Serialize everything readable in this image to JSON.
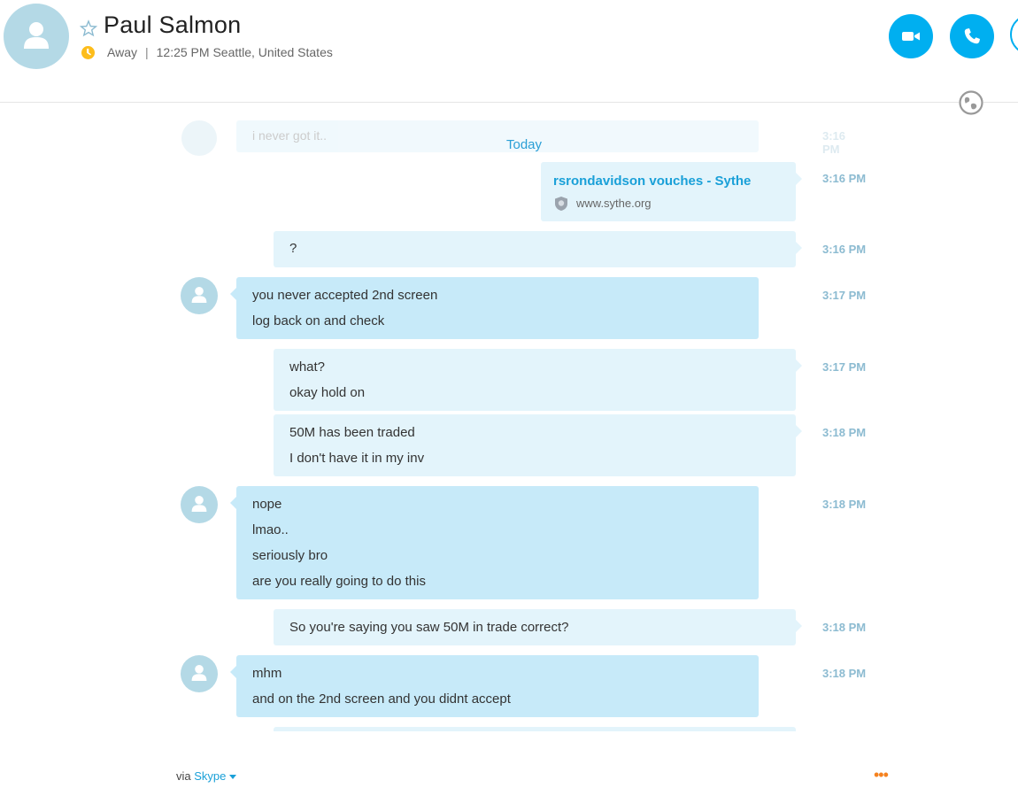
{
  "contact": {
    "name": "Paul Salmon",
    "status": "Away",
    "separator": "|",
    "local_time": "12:25 PM Seattle, United States"
  },
  "header": {
    "video_call_icon": "video-camera-icon",
    "audio_call_icon": "phone-icon"
  },
  "chat": {
    "ghost_text": "i never got it..",
    "ghost_time": "3:16 PM",
    "date_divider": "Today",
    "messages": [
      {
        "dir": "out",
        "type": "link",
        "title": "rsrondavidson vouches - Sythe",
        "url": "www.sythe.org",
        "time": "3:16 PM"
      },
      {
        "dir": "out",
        "lines": [
          "?"
        ],
        "time": "3:16 PM"
      },
      {
        "dir": "in",
        "lines": [
          "you never accepted 2nd screen",
          "log back on and check"
        ],
        "time": "3:17 PM"
      },
      {
        "dir": "out",
        "lines": [
          "what?",
          "okay hold on"
        ],
        "time": "3:17 PM"
      },
      {
        "dir": "out",
        "lines": [
          "50M has been traded",
          "I don't have it in my inv"
        ],
        "time": "3:18 PM"
      },
      {
        "dir": "in",
        "lines": [
          "nope",
          "lmao..",
          "seriously bro",
          "are you really going to do this"
        ],
        "time": "3:18 PM"
      },
      {
        "dir": "out",
        "lines": [
          "So you're saying you saw 50M in trade correct?"
        ],
        "time": "3:18 PM"
      },
      {
        "dir": "in",
        "lines": [
          "mhm",
          "and on the 2nd screen and you didnt accept"
        ],
        "time": "3:18 PM"
      }
    ]
  },
  "footer": {
    "via_prefix": "via",
    "via_link": "Skype",
    "more_label": "•••"
  },
  "colors": {
    "accent": "#00aff0",
    "incoming_bubble": "#c7eaf9",
    "outgoing_bubble": "#e3f4fb",
    "away": "#fdbd1b"
  }
}
